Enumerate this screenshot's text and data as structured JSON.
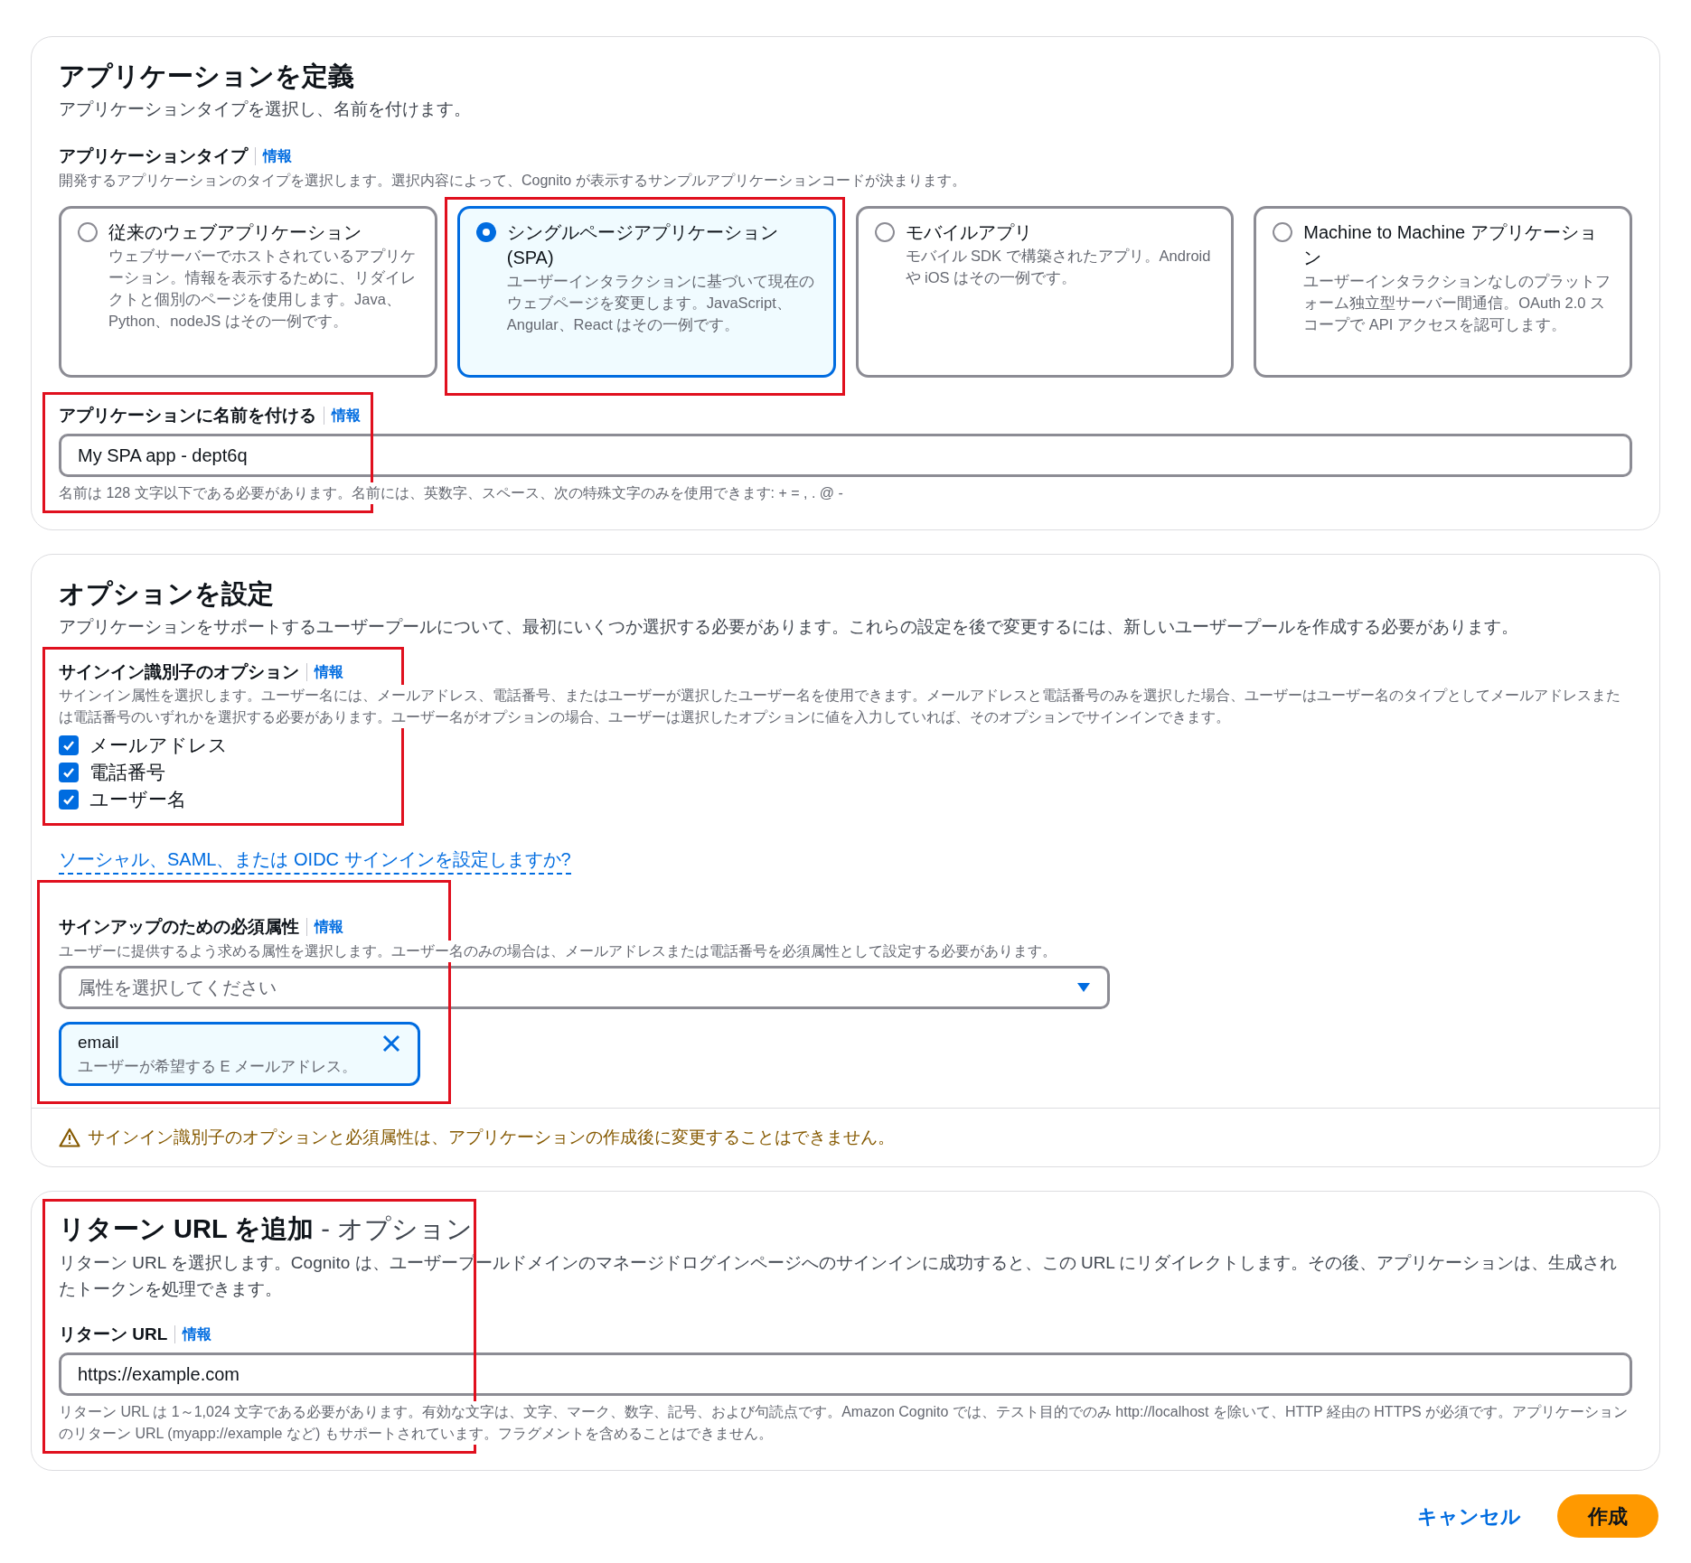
{
  "define_app": {
    "title": "アプリケーションを定義",
    "description": "アプリケーションタイプを選択し、名前を付けます。",
    "app_type": {
      "label": "アプリケーションタイプ",
      "info": "情報",
      "hint": "開発するアプリケーションのタイプを選択します。選択内容によって、Cognito が表示するサンプルアプリケーションコードが決まります。",
      "options": [
        {
          "title": "従来のウェブアプリケーション",
          "description": "ウェブサーバーでホストされているアプリケーション。情報を表示するために、リダイレクトと個別のページを使用します。Java、Python、nodeJS はその一例です。",
          "selected": false,
          "highlighted": false
        },
        {
          "title": "シングルページアプリケーション (SPA)",
          "description": "ユーザーインタラクションに基づいて現在のウェブページを変更します。JavaScript、Angular、React はその一例です。",
          "selected": true,
          "highlighted": true
        },
        {
          "title": "モバイルアプリ",
          "description": "モバイル SDK で構築されたアプリ。Android や iOS はその一例です。",
          "selected": false,
          "highlighted": false
        },
        {
          "title": "Machine to Machine アプリケーション",
          "description": "ユーザーインタラクションなしのプラットフォーム独立型サーバー間通信。OAuth 2.0 スコープで API アクセスを認可します。",
          "selected": false,
          "highlighted": false
        }
      ]
    },
    "app_name": {
      "label": "アプリケーションに名前を付ける",
      "info": "情報",
      "value": "My SPA app - dept6q",
      "hint": "名前は 128 文字以下である必要があります。名前には、英数字、スペース、次の特殊文字のみを使用できます: + = , . @ -",
      "highlighted": true
    }
  },
  "options": {
    "title": "オプションを設定",
    "description": "アプリケーションをサポートするユーザープールについて、最初にいくつか選択する必要があります。これらの設定を後で変更するには、新しいユーザープールを作成する必要があります。",
    "sign_in": {
      "label": "サインイン識別子のオプション",
      "info": "情報",
      "hint": "サインイン属性を選択します。ユーザー名には、メールアドレス、電話番号、またはユーザーが選択したユーザー名を使用できます。メールアドレスと電話番号のみを選択した場合、ユーザーはユーザー名のタイプとしてメールアドレスまたは電話番号のいずれかを選択する必要があります。ユーザー名がオプションの場合、ユーザーは選択したオプションに値を入力していれば、そのオプションでサインインできます。",
      "highlighted": true,
      "checkboxes": [
        {
          "label": "メールアドレス",
          "checked": true
        },
        {
          "label": "電話番号",
          "checked": true
        },
        {
          "label": "ユーザー名",
          "checked": true
        }
      ]
    },
    "social_link": "ソーシャル、SAML、または OIDC サインインを設定しますか?",
    "required": {
      "label": "サインアップのための必須属性",
      "info": "情報",
      "hint": "ユーザーに提供するよう求める属性を選択します。ユーザー名のみの場合は、メールアドレスまたは電話番号を必須属性として設定する必要があります。",
      "placeholder": "属性を選択してください",
      "highlighted": true,
      "tokens": [
        {
          "name": "email",
          "description": "ユーザーが希望する E メールアドレス。"
        }
      ]
    },
    "warning": "サインイン識別子のオプションと必須属性は、アプリケーションの作成後に変更することはできません。"
  },
  "return_url": {
    "title": "リターン URL を追加",
    "title_suffix": "- オプション",
    "description": "リターン URL を選択します。Cognito は、ユーザープールドメインのマネージドログインページへのサインインに成功すると、この URL にリダイレクトします。その後、アプリケーションは、生成されたトークンを処理できます。",
    "highlighted": true,
    "field": {
      "label": "リターン URL",
      "info": "情報",
      "value": "https://example.com",
      "hint": "リターン URL は 1～1,024 文字である必要があります。有効な文字は、文字、マーク、数字、記号、および句読点です。Amazon Cognito では、テスト目的でのみ http://localhost を除いて、HTTP 経由の HTTPS が必須です。アプリケーションのリターン URL (myapp://example など) もサポートされています。フラグメントを含めることはできません。"
    }
  },
  "actions": {
    "cancel": "キャンセル",
    "create": "作成"
  }
}
